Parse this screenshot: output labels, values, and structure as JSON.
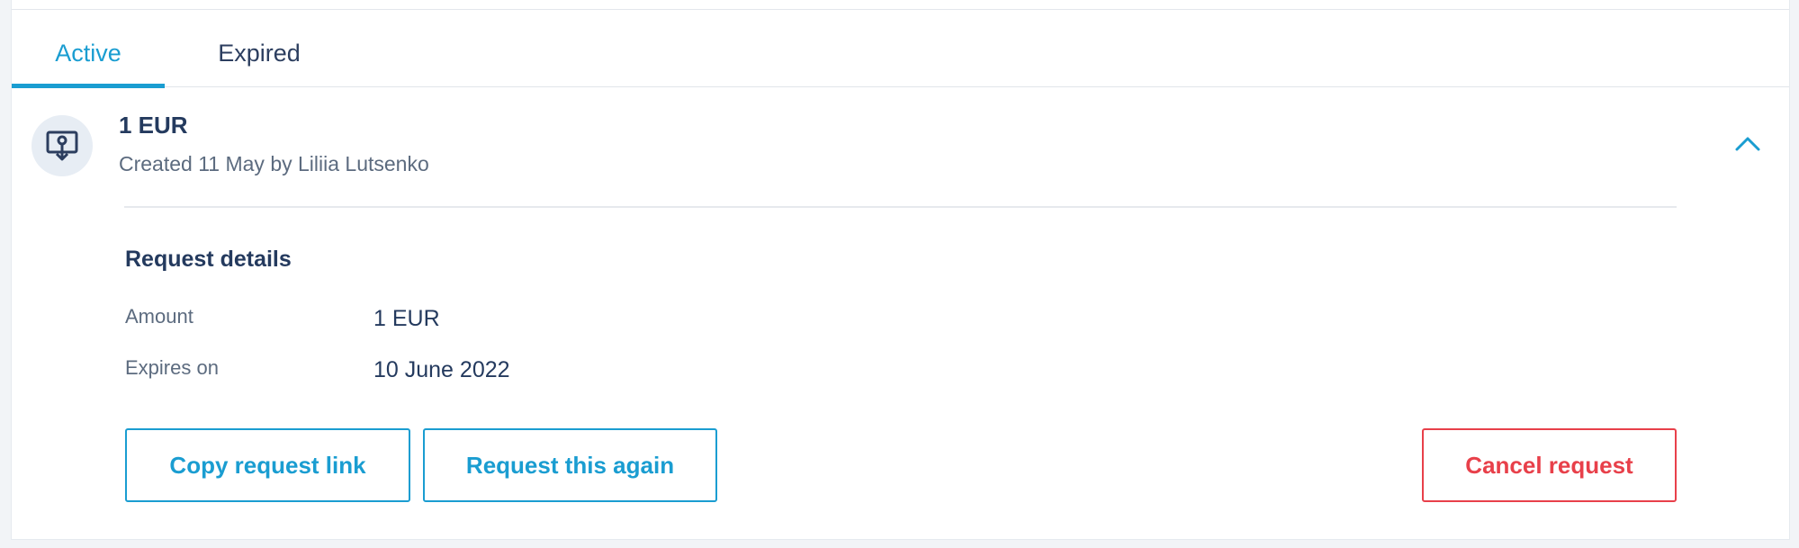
{
  "tabs": [
    {
      "label": "Active"
    },
    {
      "label": "Expired"
    }
  ],
  "request": {
    "title": "1 EUR",
    "subtitle": "Created 11 May by Liliia Lutsenko"
  },
  "details": {
    "section_title": "Request details",
    "rows": [
      {
        "label": "Amount",
        "value": "1 EUR"
      },
      {
        "label": "Expires on",
        "value": "10 June 2022"
      }
    ]
  },
  "actions": {
    "copy_link": "Copy request link",
    "request_again": "Request this again",
    "cancel": "Cancel request"
  },
  "colors": {
    "accent": "#1a9dd1",
    "danger": "#e8404a",
    "text_primary": "#243a5e",
    "text_secondary": "#5c6b7f"
  },
  "icons": {
    "request": "money-request-icon",
    "collapse": "chevron-up-icon"
  }
}
